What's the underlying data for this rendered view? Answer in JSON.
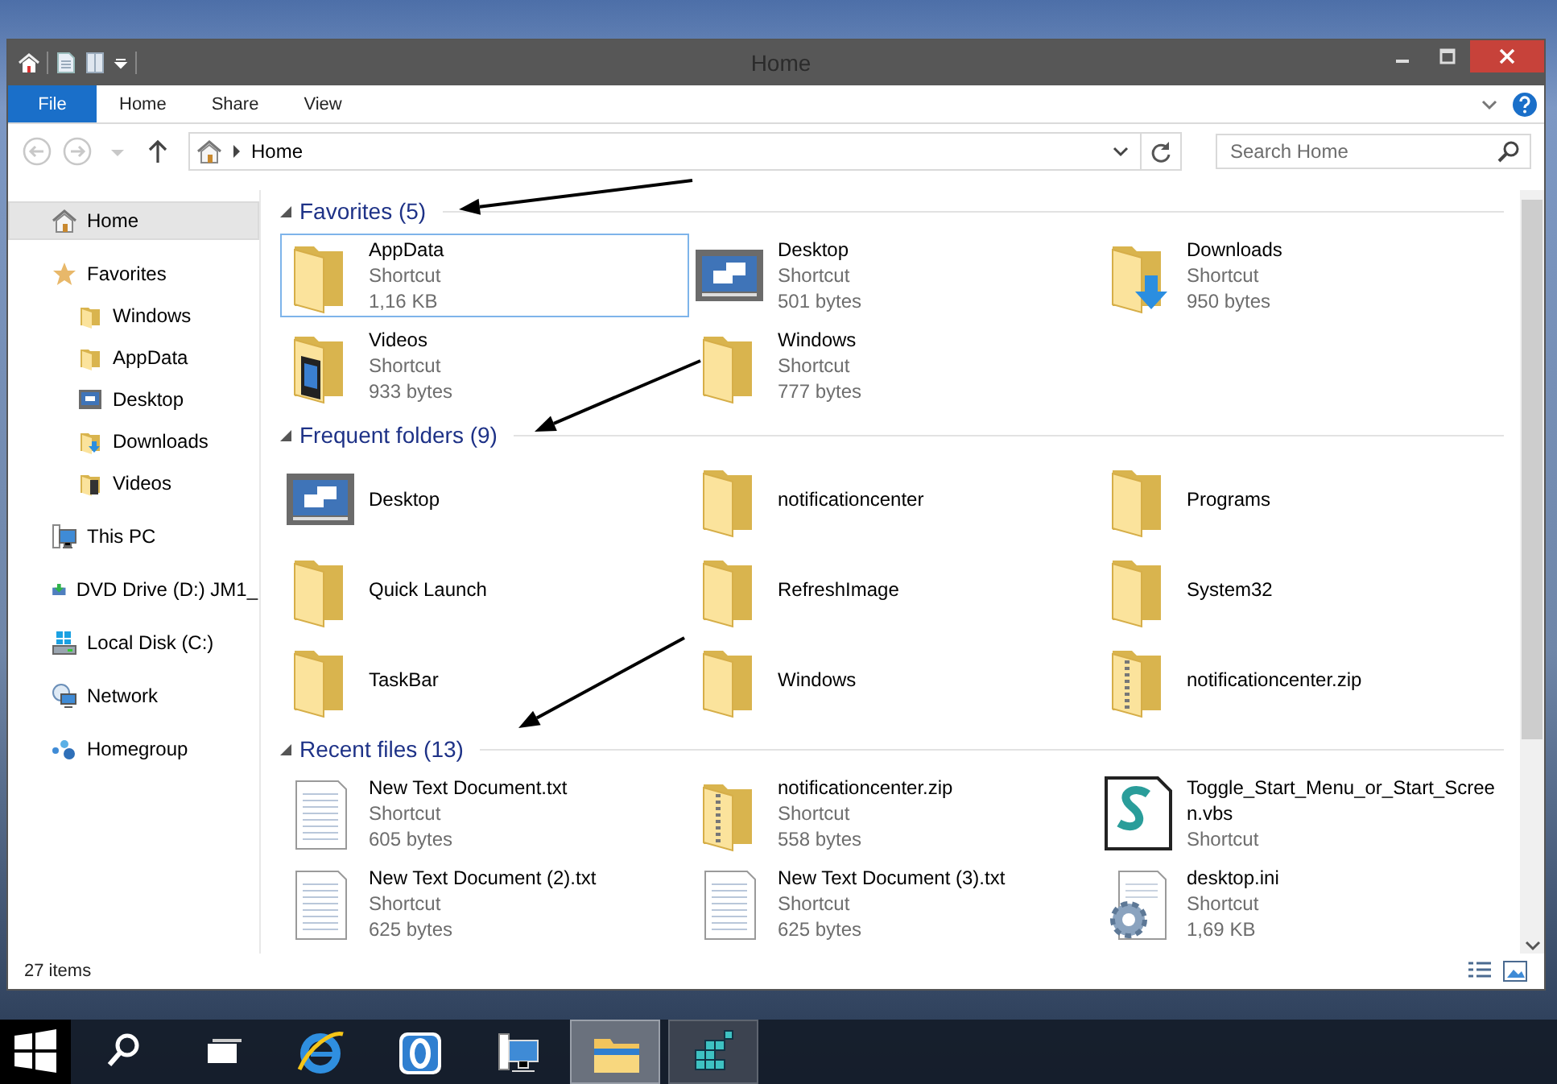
{
  "window": {
    "title": "Home"
  },
  "ribbon": {
    "tabs": [
      {
        "label": "File",
        "kind": "file",
        "selected": false
      },
      {
        "label": "Home",
        "kind": "tab",
        "selected": false
      },
      {
        "label": "Share",
        "kind": "tab",
        "selected": false
      },
      {
        "label": "View",
        "kind": "tab",
        "selected": false
      }
    ]
  },
  "address_bar": {
    "path": "Home",
    "search": {
      "placeholder": "Search Home"
    }
  },
  "sidebar": {
    "items": [
      {
        "label": "Home",
        "kind": "home",
        "selected": true
      },
      {
        "label": "Favorites",
        "kind": "star",
        "selected": false,
        "children": [
          {
            "label": "Windows",
            "kind": "folder",
            "selected": false
          },
          {
            "label": "AppData",
            "kind": "folder",
            "selected": false
          },
          {
            "label": "Desktop",
            "kind": "desktop",
            "selected": false
          },
          {
            "label": "Downloads",
            "kind": "download",
            "selected": false
          },
          {
            "label": "Videos",
            "kind": "video",
            "selected": false
          }
        ]
      },
      {
        "label": "This PC",
        "kind": "pc",
        "selected": false
      },
      {
        "label": "DVD Drive (D:) JM1_",
        "kind": "dvd",
        "selected": false
      },
      {
        "label": "Local Disk (C:)",
        "kind": "disk",
        "selected": false
      },
      {
        "label": "Network",
        "kind": "network",
        "selected": false
      },
      {
        "label": "Homegroup",
        "kind": "homegroup",
        "selected": false
      }
    ]
  },
  "sections": [
    {
      "title": "Favorites (5)",
      "items": [
        {
          "name": "AppData",
          "kind": "folder",
          "type": "Shortcut",
          "size": "1,16 KB",
          "selected": true
        },
        {
          "name": "Desktop",
          "kind": "desktop",
          "type": "Shortcut",
          "size": "501 bytes",
          "selected": false
        },
        {
          "name": "Downloads",
          "kind": "download",
          "type": "Shortcut",
          "size": "950 bytes",
          "selected": false
        },
        {
          "name": "Videos",
          "kind": "video",
          "type": "Shortcut",
          "size": "933 bytes",
          "selected": false
        },
        {
          "name": "Windows",
          "kind": "folder",
          "type": "Shortcut",
          "size": "777 bytes",
          "selected": false
        }
      ]
    },
    {
      "title": "Frequent folders (9)",
      "items": [
        {
          "name": "Desktop",
          "kind": "desktop",
          "selected": false
        },
        {
          "name": "notificationcenter",
          "kind": "folder",
          "selected": false
        },
        {
          "name": "Programs",
          "kind": "folder",
          "selected": false
        },
        {
          "name": "Quick Launch",
          "kind": "folder",
          "selected": false
        },
        {
          "name": "RefreshImage",
          "kind": "folder",
          "selected": false
        },
        {
          "name": "System32",
          "kind": "folder",
          "selected": false
        },
        {
          "name": "TaskBar",
          "kind": "folder",
          "selected": false
        },
        {
          "name": "Windows",
          "kind": "folder",
          "selected": false
        },
        {
          "name": "notificationcenter.zip",
          "kind": "zip",
          "selected": false
        }
      ]
    },
    {
      "title": "Recent files (13)",
      "items": [
        {
          "name": "New Text Document.txt",
          "kind": "text",
          "type": "Shortcut",
          "size": "605 bytes",
          "selected": false
        },
        {
          "name": "notificationcenter.zip",
          "kind": "zip",
          "type": "Shortcut",
          "size": "558 bytes",
          "selected": false
        },
        {
          "name": "Toggle_Start_Menu_or_Start_Screen.vbs",
          "kind": "script",
          "type": "Shortcut",
          "selected": false
        },
        {
          "name": "New Text Document (2).txt",
          "kind": "text",
          "type": "Shortcut",
          "size": "625 bytes",
          "selected": false
        },
        {
          "name": "New Text Document (3).txt",
          "kind": "text",
          "type": "Shortcut",
          "size": "625 bytes",
          "selected": false
        },
        {
          "name": "desktop.ini",
          "kind": "settings",
          "type": "Shortcut",
          "size": "1,69 KB",
          "selected": false
        }
      ]
    }
  ],
  "status_bar": {
    "item_count": "27 items"
  },
  "taskbar": {
    "buttons": [
      {
        "kind": "start",
        "selected": false,
        "running": false
      },
      {
        "kind": "search",
        "selected": false,
        "running": false
      },
      {
        "kind": "task-view",
        "selected": false,
        "running": false
      },
      {
        "kind": "browser",
        "selected": false,
        "running": false
      },
      {
        "kind": "o-app",
        "selected": false,
        "running": false
      },
      {
        "kind": "network-app",
        "selected": false,
        "running": false
      },
      {
        "kind": "explorer",
        "selected": true,
        "running": true
      },
      {
        "kind": "cubes",
        "selected": false,
        "running": true
      }
    ]
  }
}
